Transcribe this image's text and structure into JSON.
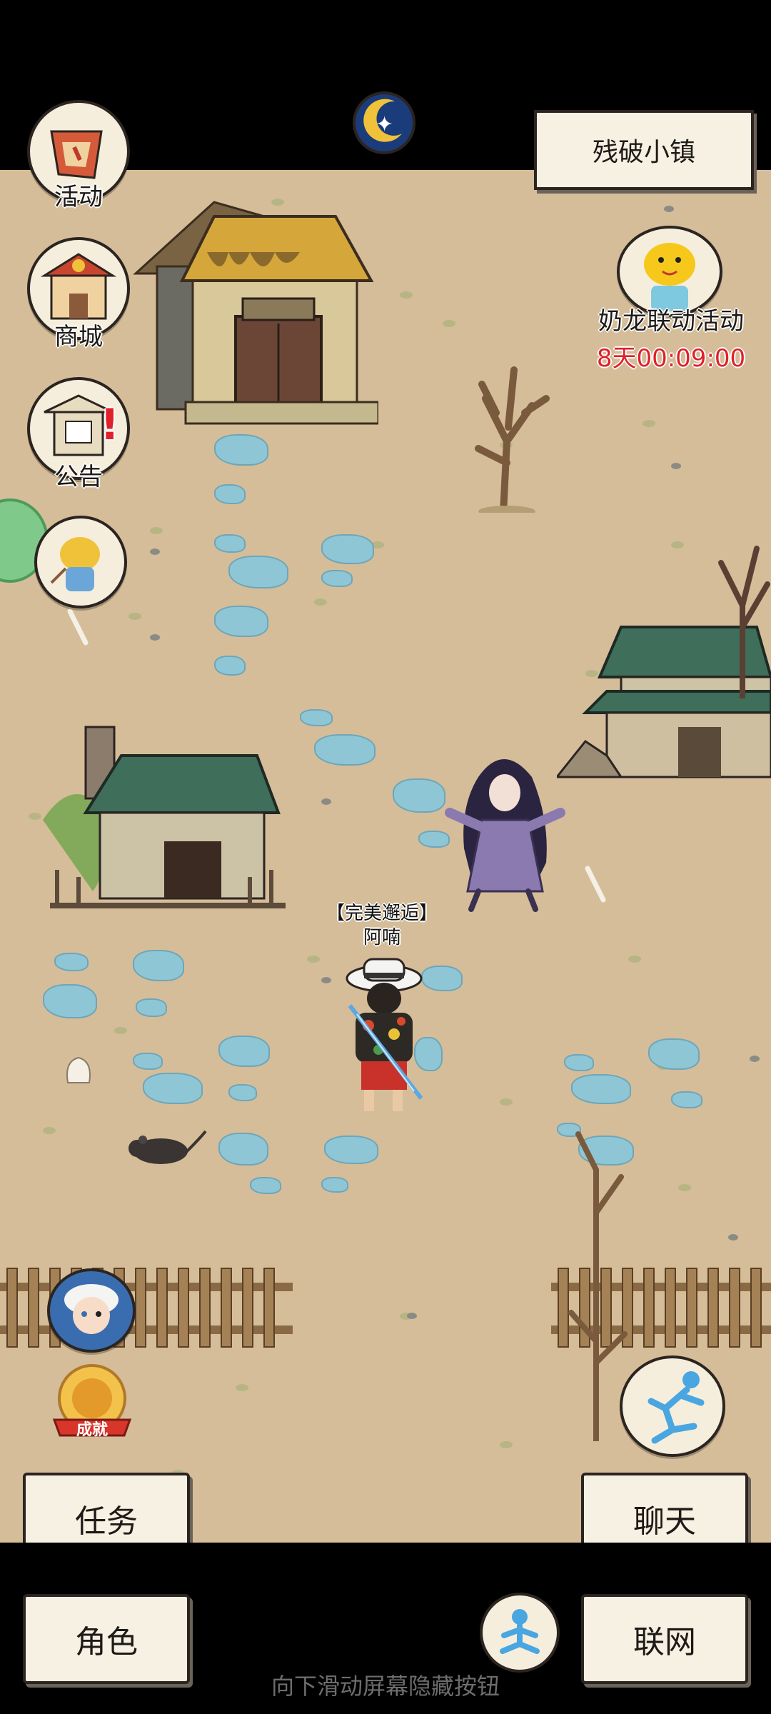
{
  "location": {
    "name": "残破小镇"
  },
  "top_badge": {
    "icon": "achievement-moon-badge-icon"
  },
  "left_menu": {
    "activity_label": "活动",
    "shop_label": "商城",
    "notice_label": "公告",
    "notice_badge": "!"
  },
  "event": {
    "title": "奶龙联动活动",
    "countdown": "8天00:09:00",
    "icon": "nailong-mascot-icon"
  },
  "player": {
    "title": "【完美邂逅】",
    "name": "阿喃"
  },
  "achievement_badge": {
    "label": "成就"
  },
  "buttons": {
    "task": "任务",
    "chat": "聊天",
    "role": "角色",
    "network": "联网"
  },
  "hint_text": "向下滑动屏幕隐藏按钮",
  "colors": {
    "ground": "#d5bd99",
    "countdown_red": "#e0202a",
    "paper": "#f7f1e3"
  }
}
